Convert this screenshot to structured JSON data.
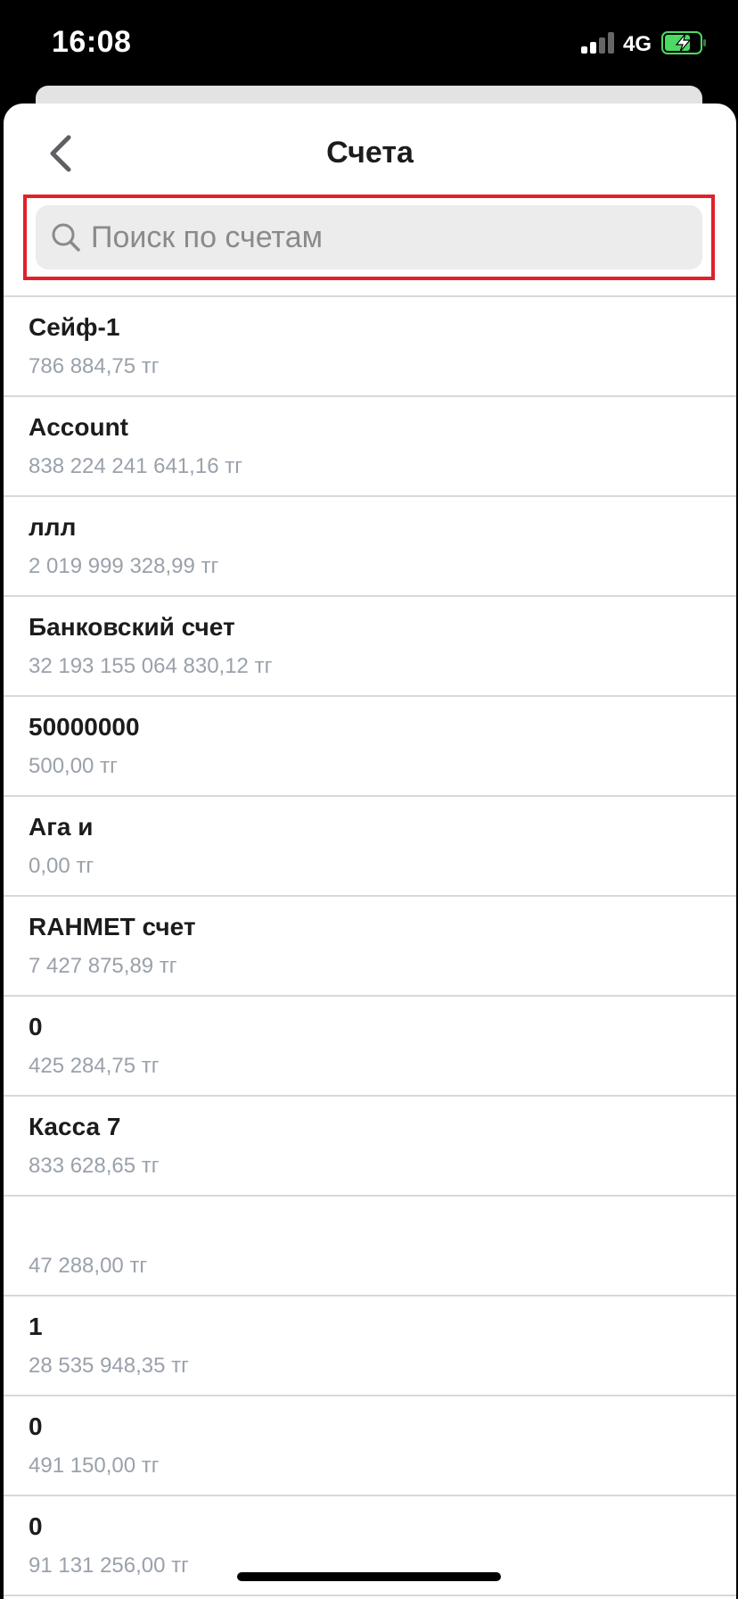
{
  "status_bar": {
    "time": "16:08",
    "network": "4G",
    "battery_color": "#4cd964"
  },
  "header": {
    "title": "Счета"
  },
  "search": {
    "placeholder": "Поиск по счетам",
    "value": ""
  },
  "accounts": [
    {
      "name": "Сейф-1",
      "amount": "786 884,75 тг"
    },
    {
      "name": "Account",
      "amount": "838 224 241 641,16 тг"
    },
    {
      "name": "ллл",
      "amount": "2 019 999 328,99 тг"
    },
    {
      "name": "Банковский счет",
      "amount": "32 193 155 064 830,12 тг"
    },
    {
      "name": "50000000",
      "amount": "500,00 тг"
    },
    {
      "name": "Ага и",
      "amount": "0,00 тг"
    },
    {
      "name": "RAHMET счет",
      "amount": "7 427 875,89 тг"
    },
    {
      "name": "0",
      "amount": "425 284,75 тг"
    },
    {
      "name": "Касса 7",
      "amount": "833 628,65 тг"
    },
    {
      "name": "",
      "amount": "47 288,00 тг"
    },
    {
      "name": "1",
      "amount": "28 535 948,35 тг"
    },
    {
      "name": "0",
      "amount": "491 150,00 тг"
    },
    {
      "name": "0",
      "amount": "91 131 256,00 тг"
    }
  ],
  "colors": {
    "highlight": "#e2202b",
    "amount_text": "#9aa1ab"
  }
}
